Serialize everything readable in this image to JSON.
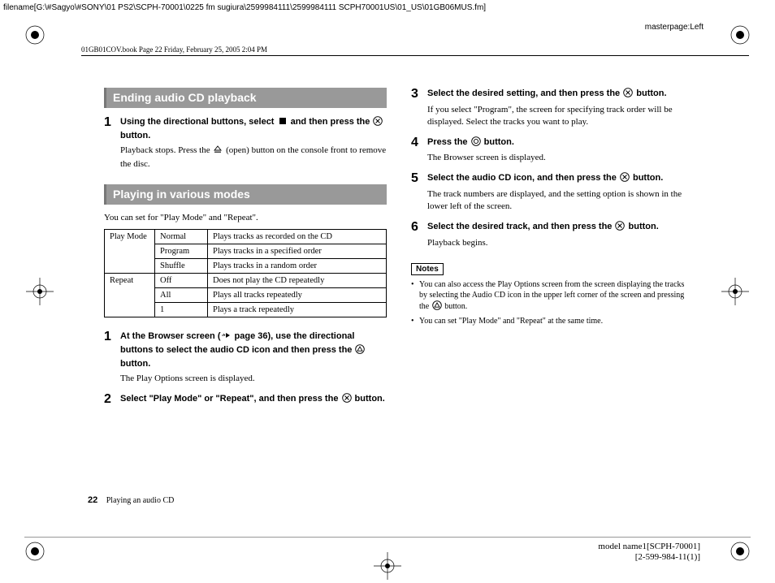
{
  "meta": {
    "filepath": "filename[G:\\#Sagyo\\#SONY\\01 PS2\\SCPH-70001\\0225 fm sugiura\\2599984111\\2599984111 SCPH70001US\\01_US\\01GB06MUS.fm]",
    "masterpage": "masterpage:Left",
    "book_line": "01GB01COV.book  Page 22  Friday, February 25, 2005  2:04 PM",
    "model_line1": "model name1[SCPH-70001]",
    "model_line2": "[2-599-984-11(1)]"
  },
  "footer": {
    "page": "22",
    "section": "Playing an audio CD"
  },
  "left": {
    "h1": "Ending audio CD playback",
    "s1_lead_a": "Using the directional buttons, select ",
    "s1_lead_b": " and then press the ",
    "s1_lead_c": " button.",
    "s1_sub_a": "Playback stops. Press the ",
    "s1_sub_b": " (open) button on the console front to remove the disc.",
    "h2": "Playing in various modes",
    "intro": "You can set for \"Play Mode\" and \"Repeat\".",
    "table": [
      {
        "group": "Play Mode",
        "option": "Normal",
        "desc": "Plays tracks as recorded on the CD"
      },
      {
        "group": "",
        "option": "Program",
        "desc": "Plays tracks in a specified order"
      },
      {
        "group": "",
        "option": "Shuffle",
        "desc": "Plays tracks in a random order"
      },
      {
        "group": "Repeat",
        "option": "Off",
        "desc": "Does not play the CD repeatedly"
      },
      {
        "group": "",
        "option": "All",
        "desc": "Plays all tracks repeatedly"
      },
      {
        "group": "",
        "option": "1",
        "desc": "Plays a track repeatedly"
      }
    ],
    "b1_lead_a": "At the Browser screen (",
    "b1_lead_b": " page 36), use the directional buttons to select the audio CD icon and then press the ",
    "b1_lead_c": " button.",
    "b1_sub": "The Play Options screen is displayed.",
    "b2_lead_a": "Select \"Play Mode\" or \"Repeat\", and then press the ",
    "b2_lead_b": " button."
  },
  "right": {
    "s3_lead_a": "Select the desired setting, and then press the ",
    "s3_lead_b": " button.",
    "s3_sub": "If you select \"Program\", the screen for specifying track order will be displayed. Select the tracks you want to play.",
    "s4_lead_a": "Press the ",
    "s4_lead_b": " button.",
    "s4_sub": "The Browser screen is displayed.",
    "s5_lead_a": "Select the audio CD icon, and then press the ",
    "s5_lead_b": " button.",
    "s5_sub": "The track numbers are displayed, and the setting option is shown in the lower left of the screen.",
    "s6_lead_a": "Select the desired track, and then press the ",
    "s6_lead_b": " button.",
    "s6_sub": "Playback begins.",
    "notes_h": "Notes",
    "note1_a": "You can also access the Play Options screen from the screen displaying the tracks by selecting the Audio CD icon in the upper left corner of the screen and pressing the ",
    "note1_b": " button.",
    "note2": "You can set \"Play Mode\" and \"Repeat\" at the same time."
  },
  "nums": {
    "n1": "1",
    "n2": "2",
    "n3": "3",
    "n4": "4",
    "n5": "5",
    "n6": "6"
  }
}
